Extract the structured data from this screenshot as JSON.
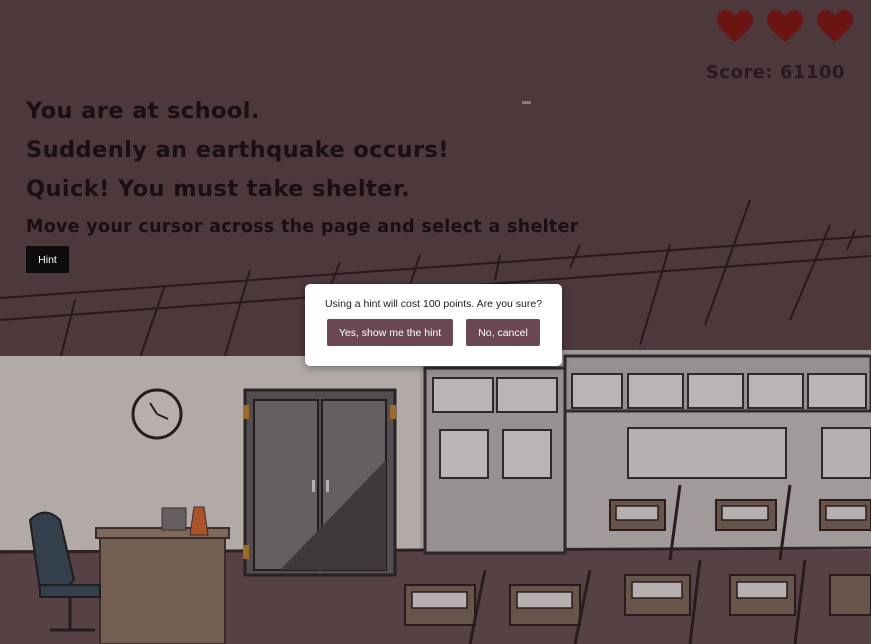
{
  "header": {
    "score_label": "Score: 61100",
    "lives": 3
  },
  "story": {
    "lines": [
      "You are at school.",
      "Suddenly an earthquake occurs!",
      "Quick! You must take shelter."
    ],
    "instruction": "Move your cursor across the page and select a shelter",
    "hint_label": "Hint"
  },
  "modal": {
    "message": "Using a hint will cost 100 points. Are you sure?",
    "confirm_label": "Yes, show me the hint",
    "cancel_label": "No, cancel"
  },
  "colors": {
    "heart": "#6b1414",
    "button": "#6b4752",
    "wall": "#4d3b3e"
  },
  "icons": [
    "heart-icon",
    "clock-icon"
  ]
}
